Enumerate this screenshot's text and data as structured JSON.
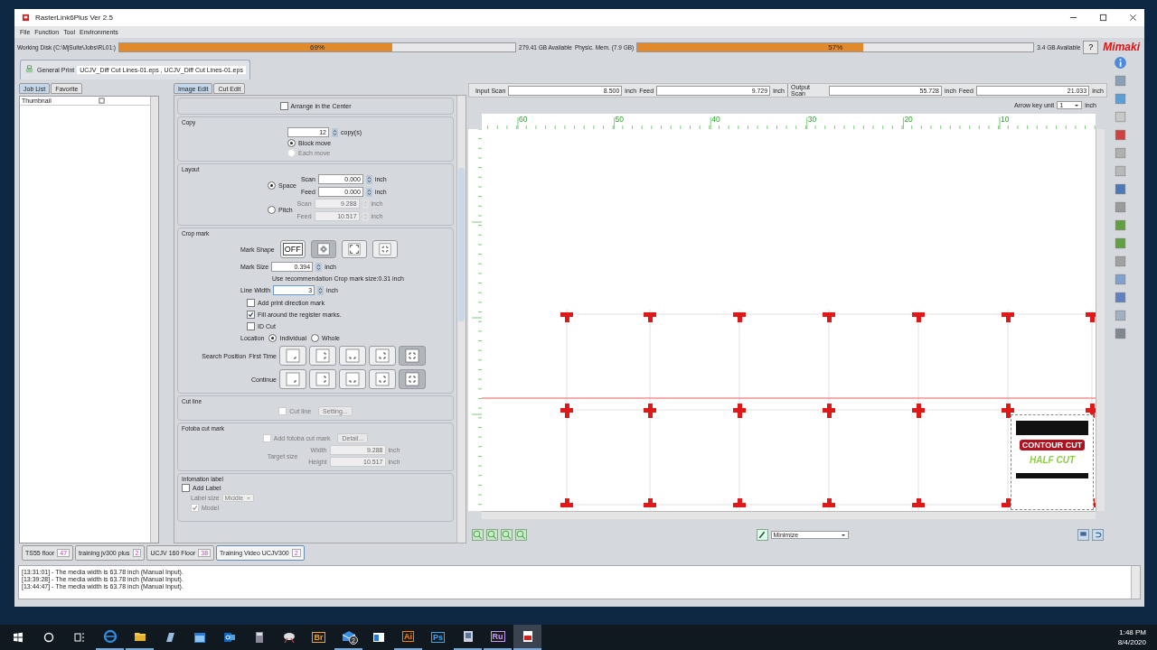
{
  "window": {
    "title": "RasterLink6Plus Ver 2.5"
  },
  "menu": [
    "File",
    "Function",
    "Tool",
    "Environments"
  ],
  "meters": [
    {
      "label": "Working Disk (C:\\MjSuite\\Jobs\\RL01:)",
      "level": 0.69,
      "reading": "69%",
      "available": "279.41 GB Available"
    },
    {
      "label": "Physic. Mem. (7.9 GB)",
      "level": 0.57,
      "reading": "57%",
      "available": "3.4 GB Available"
    }
  ],
  "help_button": "?",
  "logo": "Mimaki",
  "job_tab": {
    "label": "General Print",
    "files": "UCJV_Diff Cut Lines-01.eps , UCJV_Diff Cut Lines-01.eps"
  },
  "left_tabs": [
    {
      "label": "Job List",
      "selected": true
    },
    {
      "label": "Favorite",
      "selected": false
    }
  ],
  "job_list": {
    "header": "Thumbnail"
  },
  "edit_tabs": [
    {
      "label": "Image Edit",
      "selected": true
    },
    {
      "label": "Cut Edit",
      "selected": false
    }
  ],
  "arrange_center": {
    "label": "Arrange in the Center",
    "checked": false
  },
  "copy": {
    "title": "Copy",
    "count": "12",
    "unit": "copy(s)",
    "options": [
      {
        "label": "Block move",
        "selected": true,
        "disabled": false
      },
      {
        "label": "Each move",
        "selected": false,
        "disabled": true
      }
    ]
  },
  "layout": {
    "title": "Layout",
    "modes": [
      {
        "label": "Space",
        "selected": true,
        "fields": [
          {
            "label": "Scan",
            "value": "0.000",
            "unit": "inch"
          },
          {
            "label": "Feed",
            "value": "0.000",
            "unit": "inch"
          }
        ]
      },
      {
        "label": "Pitch",
        "selected": false,
        "fields": [
          {
            "label": "Scan",
            "value": "9.288",
            "unit": "inch"
          },
          {
            "label": "Feed",
            "value": "10.517",
            "unit": "inch"
          }
        ]
      }
    ]
  },
  "crop_mark": {
    "title": "Crop mark",
    "shape_label": "Mark Shape",
    "shapes": [
      {
        "kind": "off",
        "label": "OFF",
        "selected": false
      },
      {
        "kind": "corners-inner",
        "selected": true
      },
      {
        "kind": "brackets",
        "selected": false
      },
      {
        "kind": "corners-outer",
        "selected": false
      }
    ],
    "mark_size": {
      "label": "Mark Size",
      "value": "0.394",
      "unit": "inch"
    },
    "recommendation": "Use recommendation Crop mark size:0.31 inch",
    "line_width": {
      "label": "Line Width",
      "value": "3",
      "unit": "inch"
    },
    "checks": [
      {
        "label": "Add print direction mark",
        "checked": false
      },
      {
        "label": "Fill around the register marks.",
        "checked": true
      },
      {
        "label": "ID Cut",
        "checked": false
      }
    ],
    "location": {
      "label": "Location",
      "options": [
        {
          "label": "Individual",
          "selected": true
        },
        {
          "label": "Whole",
          "selected": false
        }
      ]
    },
    "search_title": "Search Position",
    "search_rows": [
      {
        "label": "First Time",
        "positions": [
          {
            "kind": "one",
            "selected": false
          },
          {
            "kind": "two-right",
            "selected": false
          },
          {
            "kind": "two-bottom",
            "selected": false
          },
          {
            "kind": "three",
            "selected": false
          },
          {
            "kind": "four",
            "selected": true
          }
        ]
      },
      {
        "label": "Continue",
        "positions": [
          {
            "kind": "one",
            "selected": false
          },
          {
            "kind": "two-right",
            "selected": false
          },
          {
            "kind": "two-bottom",
            "selected": false
          },
          {
            "kind": "three",
            "selected": false
          },
          {
            "kind": "four",
            "selected": true
          }
        ]
      }
    ]
  },
  "cut_line": {
    "title": "Cut line",
    "disabled": true,
    "checkbox": {
      "label": "Cut line",
      "checked": false
    },
    "button": "Setting..."
  },
  "fotoba": {
    "title": "Fotoba cut mark",
    "disabled": true,
    "checkbox": {
      "label": "Add fotoba cut mark",
      "checked": false
    },
    "button": "Detail...",
    "target_label": "Target size",
    "fields": [
      {
        "label": "Width",
        "value": "9.288",
        "unit": "inch"
      },
      {
        "label": "Height",
        "value": "10.517",
        "unit": "inch"
      }
    ]
  },
  "info_label": {
    "title": "Infomation label",
    "add": {
      "label": "Add Label",
      "checked": false
    },
    "size_label": "Label size",
    "size_value": "Middle",
    "items": [
      {
        "label": "Model",
        "checked": true
      }
    ]
  },
  "sizes": [
    {
      "label": "Input Scan",
      "scan": "8.500",
      "scan_unit": "inch",
      "feed_label": "Feed",
      "feed": "9.729",
      "feed_unit": "inch"
    },
    {
      "label": "Output Scan",
      "scan": "55.728",
      "scan_unit": "inch",
      "feed_label": "Feed",
      "feed": "21.033",
      "feed_unit": "inch"
    }
  ],
  "arrow_key": {
    "label": "Arrow key unit",
    "value": "1",
    "unit": "inch"
  },
  "ruler": {
    "top_labels": [
      "60",
      "50",
      "40",
      "30",
      "20",
      "10"
    ]
  },
  "artwork": {
    "title": "CONTOUR CUT",
    "subtitle": "HALF CUT"
  },
  "view_mode": "Minimize",
  "queues": [
    {
      "name": "TS55 floor",
      "count": "47",
      "selected": false
    },
    {
      "name": "training jv300 plus",
      "count": "2",
      "selected": false
    },
    {
      "name": "UCJV 160 Floor",
      "count": "38",
      "selected": false
    },
    {
      "name": "Training Video UCJV300",
      "count": "2",
      "selected": true
    }
  ],
  "log": [
    "[13:31:01] - The media width is 63.78 inch (Manual Input).",
    "[13:39:28] - The media width is 63.78 inch (Manual Input).",
    "[13:44:47] - The media width is 63.78 inch (Manual Input)."
  ],
  "taskbar": {
    "apps": [
      {
        "kind": "browser",
        "running": true,
        "selected": false
      },
      {
        "kind": "folder",
        "running": true,
        "selected": false
      },
      {
        "kind": "notes",
        "running": false,
        "selected": false
      },
      {
        "kind": "calendar",
        "running": false,
        "selected": false
      },
      {
        "kind": "mail-client",
        "running": false,
        "selected": false
      },
      {
        "kind": "calculator",
        "running": false,
        "selected": false
      },
      {
        "kind": "paint",
        "running": false,
        "selected": false
      },
      {
        "kind": "text",
        "label": "Br",
        "color": "#e8a33c",
        "running": false,
        "selected": false
      },
      {
        "kind": "mail",
        "badge": "2",
        "running": true,
        "selected": false
      },
      {
        "kind": "window",
        "running": false,
        "selected": false
      },
      {
        "kind": "text",
        "label": "Ai",
        "color": "#ff7c00",
        "running": true,
        "selected": false
      },
      {
        "kind": "text",
        "label": "Ps",
        "color": "#31a8ff",
        "running": false,
        "selected": false
      },
      {
        "kind": "film",
        "running": true,
        "selected": false
      },
      {
        "kind": "text",
        "label": "Ru",
        "color": "#c59aff",
        "running": true,
        "selected": false
      },
      {
        "kind": "printer-app",
        "running": true,
        "selected": true
      }
    ],
    "clock": {
      "time": "1:48 PM",
      "date": "8/4/2020"
    }
  }
}
